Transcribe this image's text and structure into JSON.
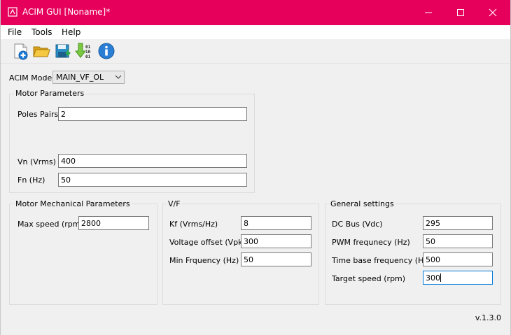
{
  "window": {
    "title": "ACIM GUI [Noname]*"
  },
  "menu": [
    "File",
    "Tools",
    "Help"
  ],
  "toolbar": {
    "icons": [
      "new-file-icon",
      "open-folder-icon",
      "save-icon",
      "download-binary-icon",
      "info-icon"
    ]
  },
  "mode": {
    "label": "ACIM Mode",
    "value": "MAIN_VF_OL"
  },
  "motor_parameters": {
    "title": "Motor Parameters",
    "poles_pairs": {
      "label": "Poles Pairs",
      "value": "2"
    },
    "vn": {
      "label": "Vn (Vrms)",
      "value": "400"
    },
    "fn": {
      "label": "Fn (Hz)",
      "value": "50"
    }
  },
  "mechanical": {
    "title": "Motor Mechanical Parameters",
    "max_speed": {
      "label": "Max speed (rpm)",
      "value": "2800"
    }
  },
  "vf": {
    "title": "V/F",
    "kf": {
      "label": "Kf (Vrms/Hz)",
      "value": "8"
    },
    "voltage_offset": {
      "label": "Voltage offset (Vpk)",
      "value": "300"
    },
    "min_frequency": {
      "label": "Min Frquency (Hz)",
      "value": "50"
    }
  },
  "general": {
    "title": "General settings",
    "dc_bus": {
      "label": "DC Bus (Vdc)",
      "value": "295"
    },
    "pwm_frequency": {
      "label": "PWM frequnecy (Hz)",
      "value": "50"
    },
    "time_base": {
      "label": "Time base frequency (Hz)",
      "value": "500"
    },
    "target_speed": {
      "label": "Target speed (rpm)",
      "value": "300"
    }
  },
  "version": "v.1.3.0",
  "colors": {
    "titlebar": "#e6005c",
    "focus_border": "#0078d7",
    "window_bg": "#f0f0f0"
  }
}
